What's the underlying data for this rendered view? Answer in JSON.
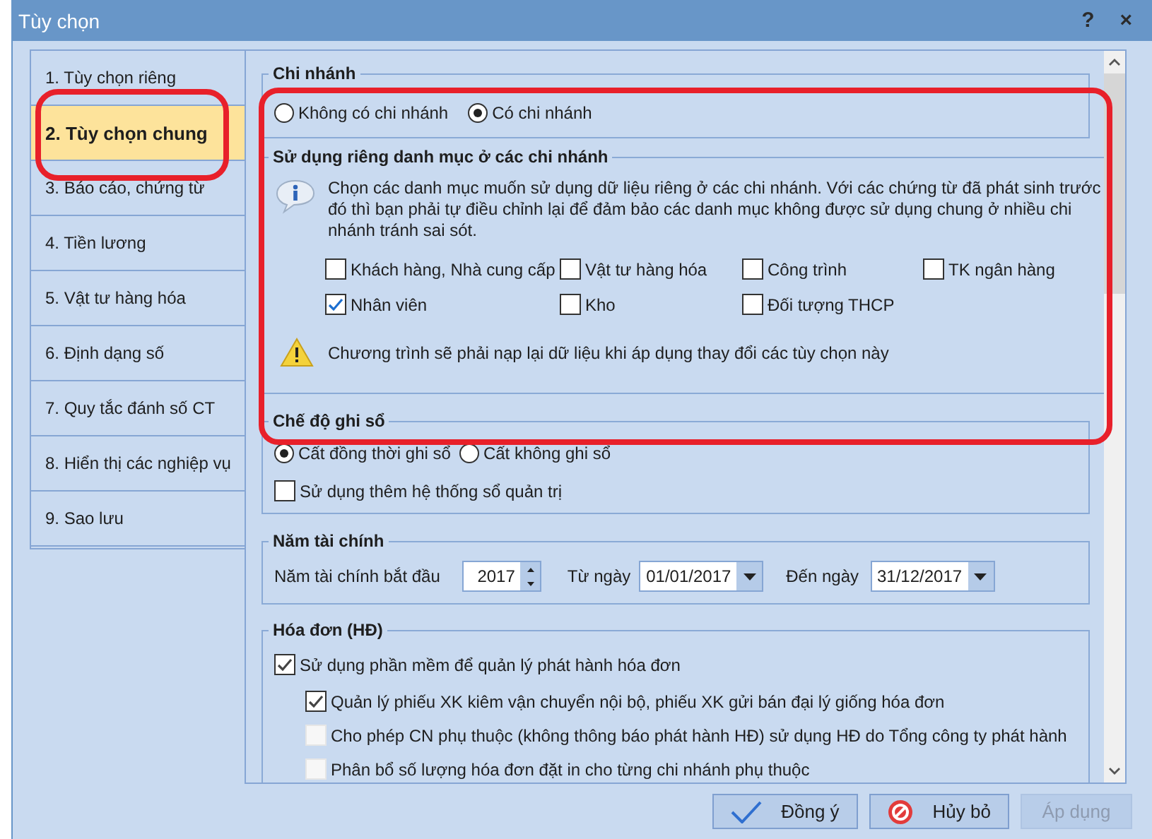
{
  "window": {
    "title": "Tùy chọn",
    "help": "?",
    "close": "×"
  },
  "nav": [
    {
      "label": "1. Tùy chọn riêng",
      "selected": false
    },
    {
      "label": "2. Tùy chọn chung",
      "selected": true
    },
    {
      "label": "3. Báo cáo, chứng từ",
      "selected": false
    },
    {
      "label": "4. Tiền lương",
      "selected": false
    },
    {
      "label": "5. Vật tư hàng hóa",
      "selected": false
    },
    {
      "label": "6. Định dạng số",
      "selected": false
    },
    {
      "label": "7. Quy tắc đánh số CT",
      "selected": false
    },
    {
      "label": "8. Hiển thị các nghiệp vụ",
      "selected": false
    },
    {
      "label": "9. Sao lưu",
      "selected": false
    }
  ],
  "branch": {
    "title": "Chi nhánh",
    "options": [
      {
        "label": "Không có chi nhánh",
        "selected": false
      },
      {
        "label": "Có chi nhánh",
        "selected": true
      }
    ]
  },
  "private_catalog": {
    "title": "Sử dụng riêng danh mục ở các chi nhánh",
    "info": "Chọn các danh mục muốn sử dụng dữ liệu riêng ở các chi nhánh. Với các chứng từ đã phát sinh trước đó thì bạn phải tự điều chỉnh lại để đảm bảo các danh mục không được sử dụng chung ở nhiều chi nhánh tránh sai sót.",
    "items": [
      {
        "label": "Khách hàng, Nhà cung cấp",
        "checked": false
      },
      {
        "label": "Vật tư hàng hóa",
        "checked": false
      },
      {
        "label": "Công trình",
        "checked": false
      },
      {
        "label": "TK ngân hàng",
        "checked": false
      },
      {
        "label": "Nhân viên",
        "checked": true
      },
      {
        "label": "Kho",
        "checked": false
      },
      {
        "label": "Đối tượng THCP",
        "checked": false
      }
    ],
    "warning": "Chương trình sẽ phải nạp lại dữ liệu khi áp dụng thay đổi các tùy chọn này"
  },
  "posting_mode": {
    "title": "Chế độ ghi sổ",
    "options": [
      {
        "label": "Cất đồng thời ghi sổ",
        "selected": true
      },
      {
        "label": "Cất không ghi sổ",
        "selected": false
      }
    ],
    "extra": {
      "label": "Sử dụng thêm hệ thống sổ quản trị",
      "checked": false
    }
  },
  "fiscal_year": {
    "title": "Năm tài chính",
    "start_label": "Năm tài chính bắt đầu",
    "start_value": "2017",
    "from_label": "Từ ngày",
    "from_value": "01/01/2017",
    "to_label": "Đến ngày",
    "to_value": "31/12/2017"
  },
  "invoice": {
    "title": "Hóa đơn (HĐ)",
    "items": [
      {
        "label": "Sử dụng phần mềm để quản lý phát hành hóa đơn",
        "checked": true,
        "disabled": false,
        "children": [
          {
            "label": "Quản lý phiếu XK kiêm vận chuyển nội bộ, phiếu XK gửi bán đại lý giống hóa đơn",
            "checked": true,
            "disabled": false
          },
          {
            "label": "Cho phép CN phụ thuộc (không thông báo phát hành HĐ) sử dụng HĐ do Tổng công ty phát hành",
            "checked": false,
            "disabled": true
          },
          {
            "label": "Phân bổ số lượng hóa đơn đặt in cho từng chi nhánh phụ thuộc",
            "checked": false,
            "disabled": true
          }
        ]
      }
    ]
  },
  "buttons": [
    {
      "label": "Đồng ý",
      "kind": "ok",
      "disabled": false
    },
    {
      "label": "Hủy bỏ",
      "kind": "cancel",
      "disabled": false
    },
    {
      "label": "Áp dụng",
      "kind": "apply",
      "disabled": true
    }
  ]
}
